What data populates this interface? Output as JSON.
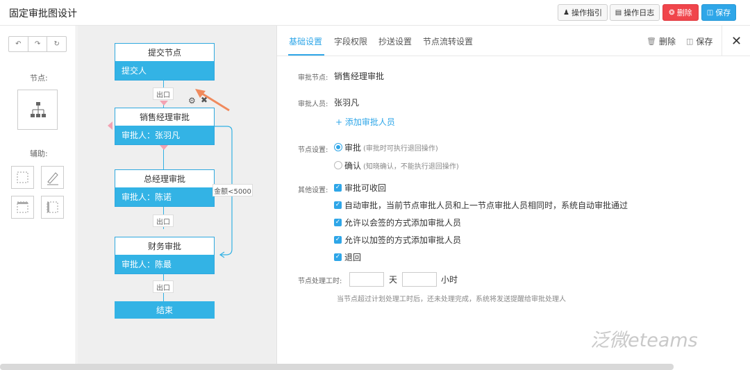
{
  "header": {
    "title": "固定审批图设计",
    "buttons": {
      "guide": "操作指引",
      "log": "操作日志",
      "delete": "删除",
      "save": "保存"
    }
  },
  "toolpanel": {
    "node_label": "节点:",
    "aux_label": "辅助:"
  },
  "canvas": {
    "nodes": [
      {
        "title": "提交节点",
        "body": "提交人"
      },
      {
        "title": "销售经理审批",
        "body": "审批人：张羽凡"
      },
      {
        "title": "总经理审批",
        "body": "审批人：陈诺"
      },
      {
        "title": "财务审批",
        "body": "审批人：陈最"
      }
    ],
    "exit_label": "出口",
    "end_label": "结束",
    "condition_label": "金额<5000"
  },
  "panel": {
    "tabs": [
      "基础设置",
      "字段权限",
      "抄送设置",
      "节点流转设置"
    ],
    "actions": {
      "delete": "删除",
      "save": "保存"
    },
    "fields": {
      "node_label": "审批节点:",
      "node_value": "销售经理审批",
      "approver_label": "审批人员:",
      "approver_value": "张羽凡",
      "add_approver": "+ 添加审批人员",
      "node_setting_label": "节点设置:",
      "radio_approve": "审批",
      "radio_approve_hint": "(审批时可执行退回操作)",
      "radio_confirm": "确认",
      "radio_confirm_hint": "(知晓确认，不能执行退回操作)",
      "other_label": "其他设置:",
      "options": [
        "审批可收回",
        "自动审批，当前节点审批人员和上一节点审批人员相同时，系统自动审批通过",
        "允许以会签的方式添加审批人员",
        "允许以加签的方式添加审批人员",
        "退回"
      ],
      "time_label": "节点处理工时:",
      "days_unit": "天",
      "hours_unit": "小时",
      "time_hint": "当节点超过计划处理工时后，还未处理完成，系统将发送提醒给审批处理人"
    }
  },
  "watermark": "泛微eteams"
}
